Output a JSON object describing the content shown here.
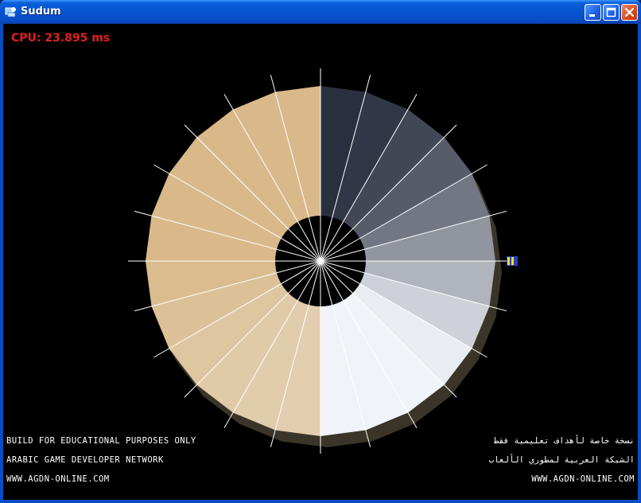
{
  "window": {
    "title": "Sudum",
    "buttons": {
      "minimize": "minimize",
      "maximize": "maximize",
      "close": "close"
    }
  },
  "hud": {
    "cpu_text": "CPU: 23.895 ms"
  },
  "footer": {
    "left_lines": [
      "BUILD FOR EDUCATIONAL PURPOSES ONLY",
      "ARABIC GAME DEVELOPER NETWORK",
      "WWW.AGDN-ONLINE.COM"
    ],
    "right_lines": [
      "نسخة خاصة لأهداف تعليمية فقط",
      "الشبكة العربية لمطوري الألعاب",
      "WWW.AGDN-ONLINE.COM"
    ]
  },
  "scene": {
    "wheel_segments": 24,
    "colors": {
      "background": "#000000",
      "cpu_text": "#e02020",
      "hub": "#000000",
      "spokes": "#ffffff",
      "marker_fill": "#f2e21a",
      "marker_edge": "#2a3fbf",
      "warm_tone": "#d9b98a",
      "cool_tone": "#d6e2ee",
      "shadow_tone": "#1c2030"
    },
    "icons": [
      "app-icon",
      "minimize-icon",
      "maximize-icon",
      "close-icon",
      "position-marker-icon"
    ]
  }
}
